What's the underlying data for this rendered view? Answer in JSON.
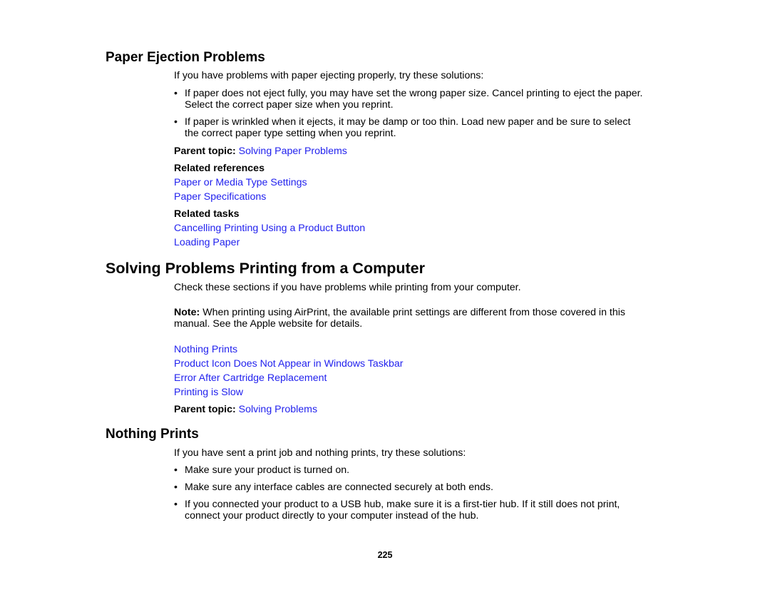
{
  "page_number": "225",
  "link_color": "#2222ee",
  "sections": {
    "paper_ejection": {
      "title": "Paper Ejection Problems",
      "intro": "If you have problems with paper ejecting properly, try these solutions:",
      "bullets": [
        {
          "line1": "If paper does not eject fully, you may have set the wrong paper size. Cancel printing to eject the paper.",
          "line2": "Select the correct paper size when you reprint."
        },
        {
          "line1": "If paper is wrinkled when it ejects, it may be damp or too thin. Load new paper and be sure to select",
          "line2": "the correct paper type setting when you reprint."
        }
      ],
      "parent_topic_label": "Parent topic:",
      "parent_topic_link": "Solving Paper Problems",
      "related_references_label": "Related references",
      "related_references": [
        "Paper or Media Type Settings",
        "Paper Specifications"
      ],
      "related_tasks_label": "Related tasks",
      "related_tasks": [
        "Cancelling Printing Using a Product Button",
        "Loading Paper"
      ]
    },
    "printing_from_computer": {
      "title": "Solving Problems Printing from a Computer",
      "intro": "Check these sections if you have problems while printing from your computer.",
      "note_label": "Note:",
      "note_line1": "When printing using AirPrint, the available print settings are different from those covered in this",
      "note_line2": "manual. See the Apple website for details.",
      "links": [
        "Nothing Prints",
        "Product Icon Does Not Appear in Windows Taskbar",
        "Error After Cartridge Replacement",
        "Printing is Slow"
      ],
      "parent_topic_label": "Parent topic:",
      "parent_topic_link": "Solving Problems"
    },
    "nothing_prints": {
      "title": "Nothing Prints",
      "intro": "If you have sent a print job and nothing prints, try these solutions:",
      "bullets": [
        {
          "line1": "Make sure your product is turned on.",
          "line2": ""
        },
        {
          "line1": "Make sure any interface cables are connected securely at both ends.",
          "line2": ""
        },
        {
          "line1": "If you connected your product to a USB hub, make sure it is a first-tier hub. If it still does not print,",
          "line2": "connect your product directly to your computer instead of the hub."
        }
      ]
    }
  }
}
